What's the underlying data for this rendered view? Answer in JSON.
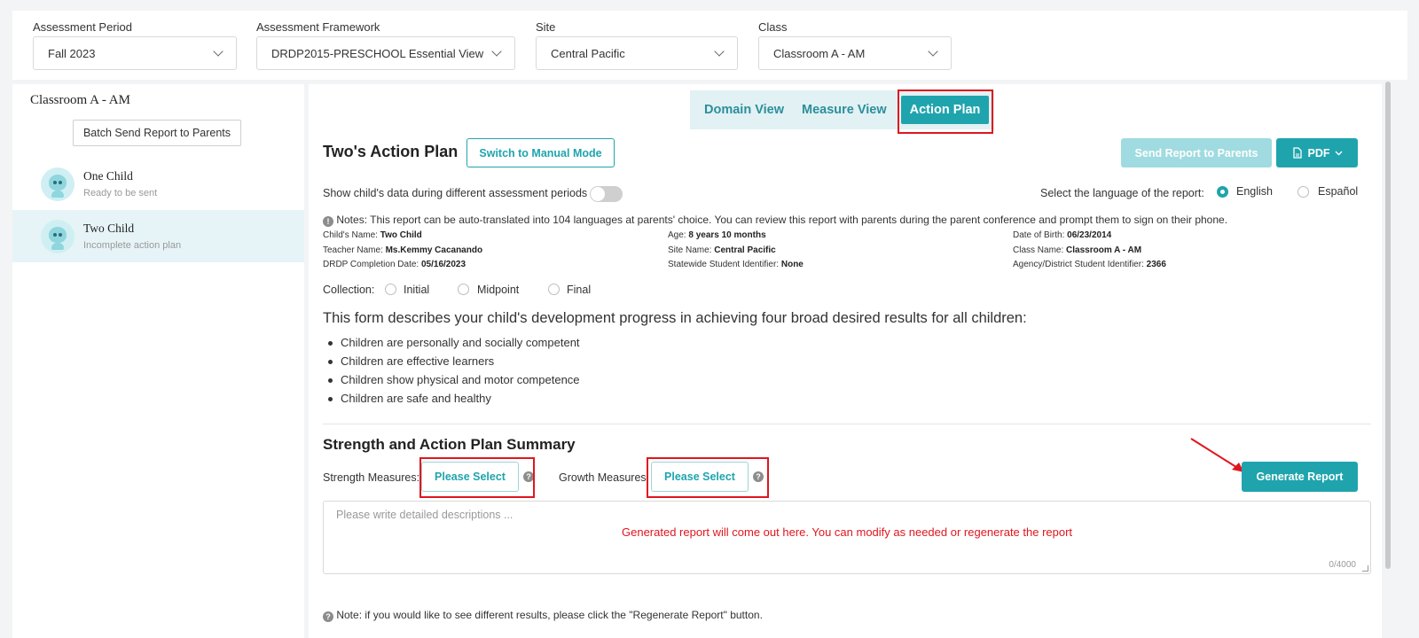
{
  "filters": [
    {
      "label": "Assessment Period",
      "value": "Fall 2023"
    },
    {
      "label": "Assessment Framework",
      "value": "DRDP2015-PRESCHOOL Essential View"
    },
    {
      "label": "Site",
      "value": "Central Pacific"
    },
    {
      "label": "Class",
      "value": "Classroom A - AM"
    }
  ],
  "sidebar": {
    "title": "Classroom A - AM",
    "batch_button": "Batch Send Report to Parents",
    "children": [
      {
        "name": "One Child",
        "status": "Ready to be sent"
      },
      {
        "name": "Two Child",
        "status": "Incomplete action plan"
      }
    ]
  },
  "tabs": [
    "Domain View",
    "Measure View",
    "Action Plan"
  ],
  "plan": {
    "title": "Two's Action Plan",
    "switch_button": "Switch to Manual Mode",
    "send_button": "Send Report to Parents",
    "pdf_button": "PDF",
    "toggle_label": "Show child's data during different assessment periods",
    "language_label": "Select the language of the report:",
    "language_options": [
      "English",
      "Español"
    ],
    "notes": "Notes: This report can be auto-translated into 104 languages at parents' choice. You can review this report with parents during the parent conference and prompt them to sign on their phone."
  },
  "info": [
    {
      "label": "Child's Name:",
      "value": "Two Child"
    },
    {
      "label": "Age:",
      "value": "8 years 10 months"
    },
    {
      "label": "Date of Birth:",
      "value": "06/23/2014"
    },
    {
      "label": "Teacher Name:",
      "value": "Ms.Kemmy Cacanando"
    },
    {
      "label": "Site Name:",
      "value": "Central Pacific"
    },
    {
      "label": "Class Name:",
      "value": "Classroom A - AM"
    },
    {
      "label": "DRDP Completion Date:",
      "value": "05/16/2023"
    },
    {
      "label": "Statewide Student Identifier:",
      "value": "None"
    },
    {
      "label": "Agency/District Student Identifier:",
      "value": "2366"
    }
  ],
  "collection": {
    "label": "Collection:",
    "options": [
      "Initial",
      "Midpoint",
      "Final"
    ]
  },
  "description": {
    "heading": "This form describes your child's development progress in achieving four broad desired results for all children:",
    "bullets": [
      "Children are personally and socially competent",
      "Children are effective learners",
      "Children show physical and motor competence",
      "Children are safe and healthy"
    ]
  },
  "summary": {
    "title": "Strength and Action Plan Summary",
    "strength_label": "Strength Measures:",
    "growth_label": "Growth Measures:",
    "select_label": "Please Select",
    "generate_button": "Generate Report",
    "placeholder": "Please write detailed descriptions ...",
    "generated_hint": "Generated report will come out here. You can modify as needed or regenerate the report",
    "counter": "0/4000",
    "note": "Note: if you would like to see different results, please click the \"Regenerate Report\" button."
  },
  "colors": {
    "accent": "#1fa4ad",
    "highlight": "#e0161e"
  }
}
